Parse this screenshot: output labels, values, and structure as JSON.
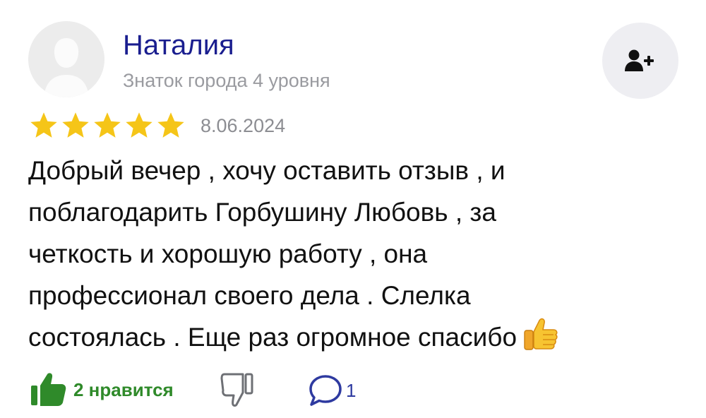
{
  "author": {
    "name": "Наталия",
    "level": "Знаток города 4 уровня",
    "avatar_icon": "user-silhouette-icon"
  },
  "subscribe": {
    "icon": "add-user-icon"
  },
  "review": {
    "rating": 5,
    "rating_max": 5,
    "date": "8.06.2024",
    "lines": [
      "Добрый вечер , хочу оставить отзыв , и",
      "поблагодарить Горбушину Любовь , за",
      "четкость и хорошую работу , она",
      "профессионал своего дела . Слелка",
      "состоялась . Еще раз огромное спасибо"
    ],
    "trailing_emoji": "👍"
  },
  "actions": {
    "like_label": "2 нравится",
    "like_icon": "thumbs-up-icon",
    "dislike_icon": "thumbs-down-icon",
    "comment_icon": "comment-bubble-icon",
    "comment_count": "1"
  },
  "colors": {
    "name": "#1a1e8f",
    "star": "#f5c518",
    "like": "#2f8a2a",
    "comment": "#2e3aa0",
    "muted": "#9a9ba0"
  }
}
